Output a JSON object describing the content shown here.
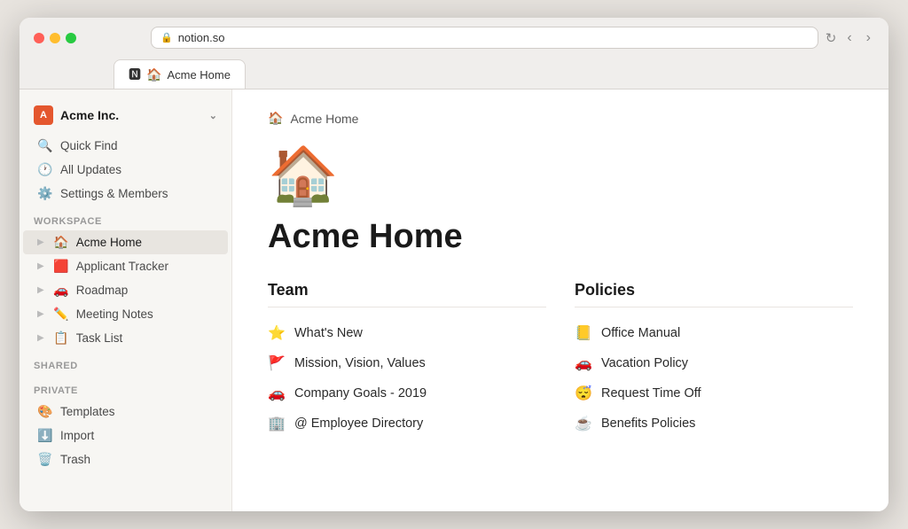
{
  "browser": {
    "url": "notion.so",
    "tab_label": "Acme Home",
    "tab_favicon_notion": "🅽",
    "tab_favicon_page": "🏠"
  },
  "sidebar": {
    "workspace_name": "Acme Inc.",
    "quick_find": "Quick Find",
    "all_updates": "All Updates",
    "settings": "Settings & Members",
    "workspace_label": "WORKSPACE",
    "shared_label": "SHARED",
    "private_label": "PRIVATE",
    "nav_items": [
      {
        "id": "acme-home",
        "label": "Acme Home",
        "emoji": "🏠",
        "active": true
      },
      {
        "id": "applicant-tracker",
        "label": "Applicant Tracker",
        "emoji": "🟥",
        "active": false
      },
      {
        "id": "roadmap",
        "label": "Roadmap",
        "emoji": "🚗",
        "active": false
      },
      {
        "id": "meeting-notes",
        "label": "Meeting Notes",
        "emoji": "✏️",
        "active": false
      },
      {
        "id": "task-list",
        "label": "Task List",
        "emoji": "📋",
        "active": false
      }
    ],
    "bottom_items": [
      {
        "id": "templates",
        "label": "Templates",
        "emoji": "🎨"
      },
      {
        "id": "import",
        "label": "Import",
        "emoji": "⬇️"
      },
      {
        "id": "trash",
        "label": "Trash",
        "emoji": "🗑️"
      }
    ]
  },
  "page": {
    "breadcrumb": "Acme Home",
    "breadcrumb_emoji": "🏠",
    "page_emoji": "🏠",
    "title": "Acme Home",
    "team_heading": "Team",
    "policies_heading": "Policies",
    "team_items": [
      {
        "emoji": "⭐",
        "label": "What's New"
      },
      {
        "emoji": "🚩",
        "label": "Mission, Vision, Values"
      },
      {
        "emoji": "🚗",
        "label": "Company Goals - 2019"
      },
      {
        "emoji": "🏢",
        "label": "Employee Directory"
      }
    ],
    "policy_items": [
      {
        "emoji": "📒",
        "label": "Office Manual"
      },
      {
        "emoji": "🚗",
        "label": "Vacation Policy"
      },
      {
        "emoji": "😴",
        "label": "Request Time Off"
      },
      {
        "emoji": "☕",
        "label": "Benefits Policies"
      }
    ]
  }
}
